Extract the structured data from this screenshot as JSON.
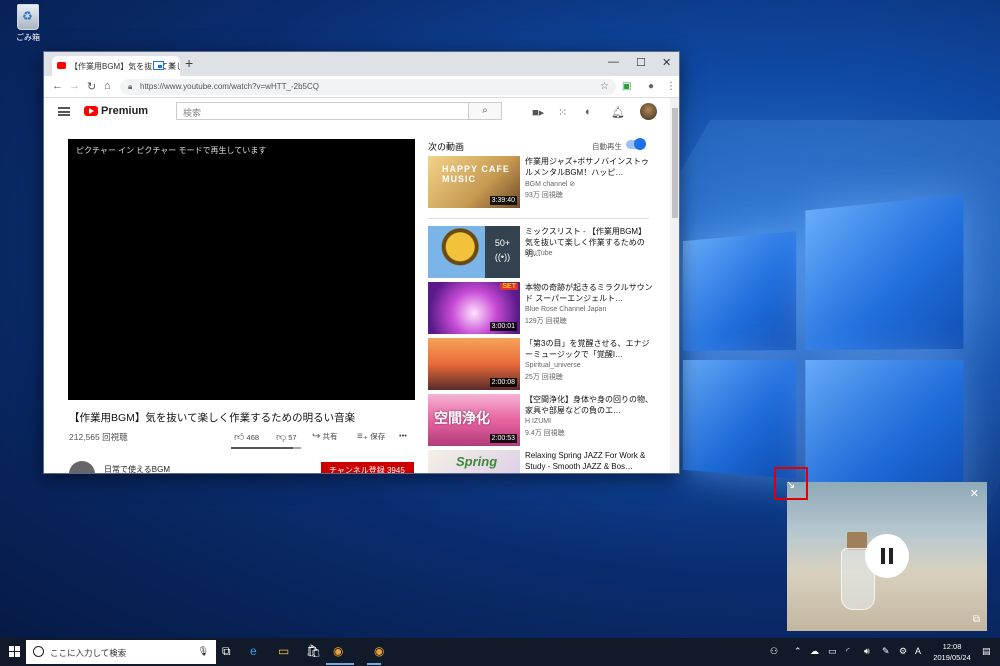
{
  "desktop": {
    "recycle_bin_label": "ごみ箱"
  },
  "browser": {
    "tab_title": "【作業用BGM】気を抜いて楽し",
    "new_tab": "+",
    "window_controls": {
      "minimize": "—",
      "maximize": "☐",
      "close": "✕"
    },
    "url": "https://www.youtube.com/watch?v=wHTT_-2b5CQ"
  },
  "youtube": {
    "brand": "Premium",
    "search_placeholder": "検索",
    "player_message": "ピクチャー イン ピクチャー モードで再生しています",
    "video_title": "【作業用BGM】気を抜いて楽しく作業するための明るい音楽",
    "view_count": "212,565 回視聴",
    "likes": "468",
    "dislikes": "57",
    "like_ratio": 0.89,
    "share_label": "共有",
    "save_label": "保存",
    "more_label": "•••",
    "channel_name": "日常で使えるBGM",
    "subscribe_label": "チャンネル登録 3945",
    "up_next_label": "次の動画",
    "autoplay_label": "自動再生",
    "autoplay_on": true,
    "recommendations": [
      {
        "title": "作業用ジャズ+ボサノバインストゥルメンタルBGM！ハッピ…",
        "channel": "BGM channel ⊘",
        "views": "93万 回視聴",
        "duration": "3:39:40",
        "thumb_text": "HAPPY CAFE MUSIC"
      },
      {
        "title": "ミックスリスト - 【作業用BGM】気を抜いて楽しく作業するための明…",
        "channel": "YouTube",
        "views": "",
        "duration": "",
        "playlist_count": "50+",
        "playlist_icon": "((•))"
      },
      {
        "title": "本物の奇跡が起きるミラクルサウンド スーパーエンジェルト…",
        "channel": "Blue Rose Channel Japan",
        "views": "129万 回視聴",
        "duration": "3:00:01",
        "thumb_text": "SET"
      },
      {
        "title": "「第3の目」を覚醒させる、エナジーミュージックで「覚醒I…",
        "channel": "Spiritual_universe",
        "views": "25万 回視聴",
        "duration": "2:00:08"
      },
      {
        "title": "【空間浄化】身体や身の回りの物、家具や部屋などの負のエ…",
        "channel": "H IZUMI",
        "views": "9.4万 回視聴",
        "duration": "2:00:53",
        "thumb_text": "空間浄化"
      },
      {
        "title": "Relaxing Spring JAZZ For Work & Study - Smooth JAZZ & Bos…",
        "channel": "",
        "views": "",
        "duration": "",
        "thumb_text": "Spring"
      }
    ]
  },
  "pip_window": {
    "close": "✕",
    "resize_handle": "↘",
    "back_to_tab": "⧉"
  },
  "taskbar": {
    "search_placeholder": "ここに入力して検索",
    "time": "12:08",
    "date": "2019/05/24"
  },
  "colors": {
    "youtube_red": "#ff0000",
    "subscribe_red": "#cc0000",
    "chrome_tabbar": "#dee1e6",
    "taskbar": "#101a28",
    "highlight": "#e10000",
    "accent_blue": "#1a73e8"
  }
}
